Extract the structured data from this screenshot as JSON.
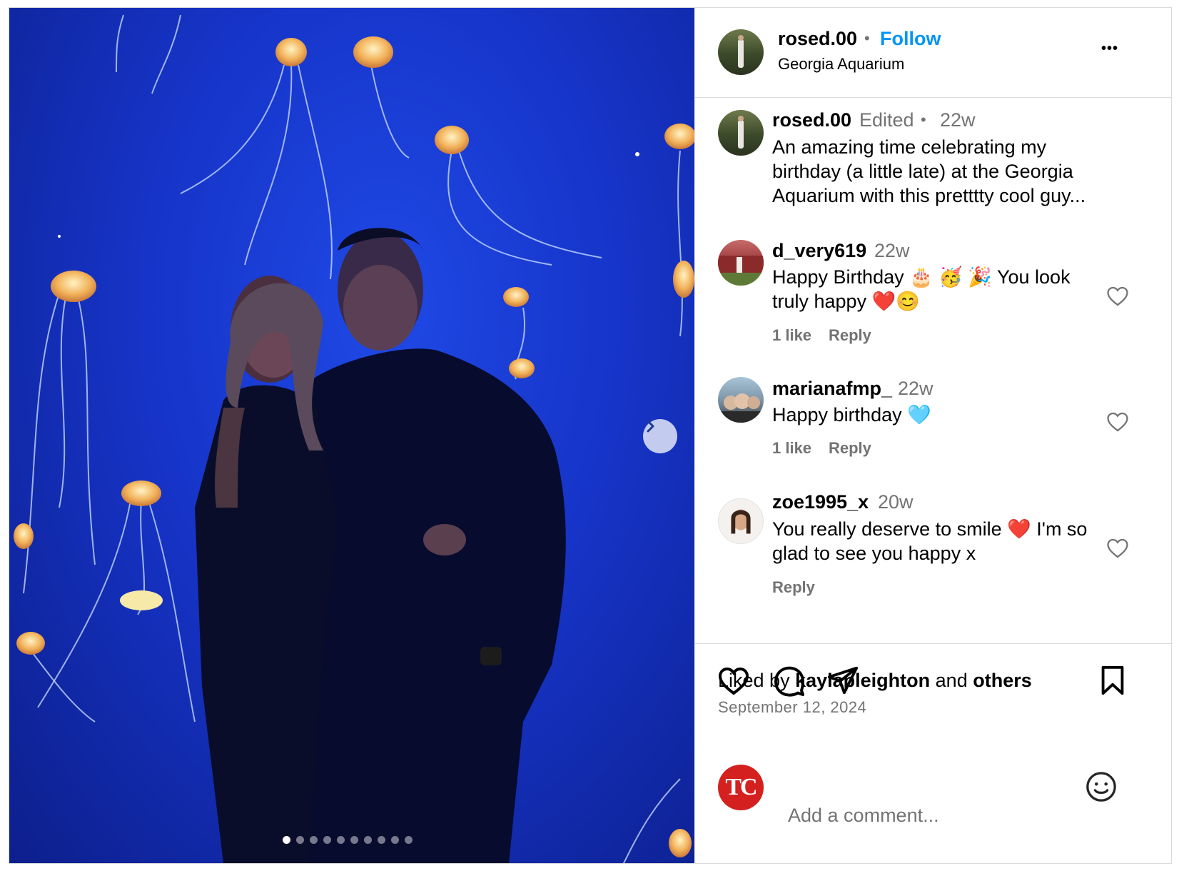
{
  "post": {
    "photo_alt": "Couple posing in front of jellyfish tank",
    "carousel_count": 10,
    "carousel_active": 0
  },
  "header": {
    "username": "rosed.00",
    "separator": "•",
    "follow_label": "Follow",
    "location": "Georgia Aquarium",
    "more_label": "•••"
  },
  "caption": {
    "username": "rosed.00",
    "edited": "Edited",
    "separator": "•",
    "time": "22w",
    "lines": [
      "An amazing time celebrating my",
      "birthday (a little late) at the Georgia",
      "Aquarium with this pretttty cool guy..."
    ]
  },
  "comments": [
    {
      "username": "d_very619",
      "time": "22w",
      "lines": [
        "Happy Birthday 🎂 🥳 🎉 You look",
        "truly happy ❤️😊"
      ],
      "likes": "1 like",
      "reply": "Reply"
    },
    {
      "username": "marianafmp_",
      "time": "22w",
      "lines": [
        "Happy birthday 🩵"
      ],
      "likes": "1 like",
      "reply": "Reply"
    },
    {
      "username": "zoe1995_x",
      "time": "20w",
      "lines": [
        "You really deserve to smile ❤️ I'm so",
        "glad to see you happy x"
      ],
      "reply": "Reply"
    }
  ],
  "footer": {
    "liked_by_prefix": "Liked by",
    "liked_by_user": "kaylapleighton",
    "liked_by_and": "and",
    "liked_by_others": "others",
    "date": "September 12, 2024",
    "avatar_text": "TC",
    "comment_placeholder": "Add a comment..."
  },
  "colors": {
    "follow": "#0095f6",
    "muted": "#737373",
    "aquarium_blue": "#1634c8",
    "tc_red": "#d4201e"
  },
  "icons": [
    "chevron-right-icon",
    "more-icon",
    "heart-icon",
    "comment-icon",
    "share-icon",
    "bookmark-icon",
    "emoji-icon"
  ]
}
